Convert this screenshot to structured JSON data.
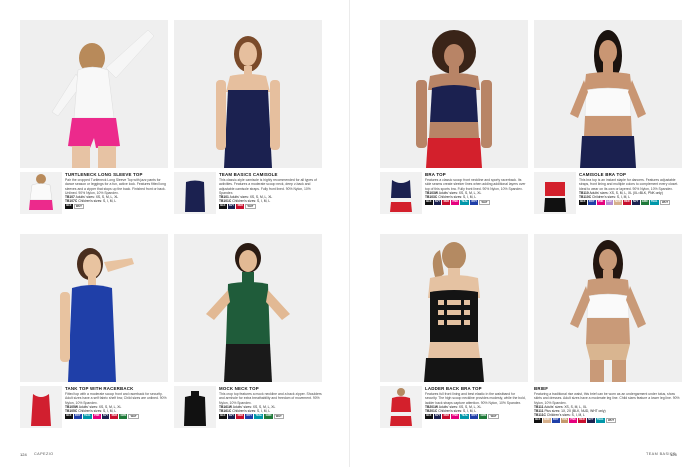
{
  "products": [
    {
      "title": "TURTLENECK LONG SLEEVE TOP",
      "desc": "Pair the cropped Turtleneck Long Sleeve Top with jazz pants for dance season or leggings for a fun, active look. Features fitted long sleeves and a zipper that stops up the back. Finished front or back. Unlined. 90% Nylon, 10% Spandex.",
      "sizes": [
        {
          "code": "TB107",
          "text": "Adults' sizes: XS, S, M, L, XL"
        },
        {
          "code": "TB107C",
          "text": "Children's sizes: S, I, M, L"
        }
      ],
      "swatches": [
        {
          "label": "BLK",
          "color": "#111111",
          "light": false
        },
        {
          "label": "WHT",
          "color": "#ffffff",
          "light": true
        }
      ]
    },
    {
      "title": "TEAM BASICS CAMISOLE",
      "desc": "This classic-style camisole is highly recommended for all types of activities. Features a moderate scoop neck, deep v-back and adjustable camisole straps. Fully front lined. 90% Nylon, 10% Spandex.",
      "sizes": [
        {
          "code": "TB101",
          "text": "Adults' sizes: XS, S, M, L, XL"
        },
        {
          "code": "TB101C",
          "text": "Children's sizes: S, I, M, L"
        }
      ],
      "swatches": [
        {
          "label": "BLK",
          "color": "#111111",
          "light": false
        },
        {
          "label": "NVY",
          "color": "#1c2250",
          "light": false
        },
        {
          "label": "RED",
          "color": "#c8102e",
          "light": false
        },
        {
          "label": "WHT",
          "color": "#ffffff",
          "light": true
        }
      ]
    },
    {
      "title": "BRA TOP",
      "desc": "Features a classic scoop front neckline and sporty racerback. Its side seams create sleeker lines when adding additional layers over top of this sports bra. Fully front lined. 90% Nylon, 10% Spandex.",
      "sizes": [
        {
          "code": "TB103W",
          "text": "Adults' sizes: XS, S, M, L, XL"
        },
        {
          "code": "TB103C",
          "text": "Children's sizes: S, I, M, L"
        }
      ],
      "swatches": [
        {
          "label": "BLK",
          "color": "#111111",
          "light": false
        },
        {
          "label": "NVY",
          "color": "#1c2250",
          "light": false
        },
        {
          "label": "RED",
          "color": "#c8102e",
          "light": false
        },
        {
          "label": "PNK",
          "color": "#e6007e",
          "light": false
        },
        {
          "label": "TEAL",
          "color": "#0097a9",
          "light": false
        },
        {
          "label": "ROY",
          "color": "#1f3fa8",
          "light": false
        },
        {
          "label": "WHT",
          "color": "#ffffff",
          "light": true
        }
      ]
    },
    {
      "title": "CAMISOLE BRA TOP",
      "desc": "This bra top is an instant staple for dancers. Features adjustable straps, front lining and multiple colors to complement every closet. Ideal to wear on its own or layered. 90% Nylon, 10% Spandex.",
      "sizes": [
        {
          "code": "TB110",
          "text": "Adults' sizes: XS, S, M, L, XL (XL=BLK, PNK only)"
        },
        {
          "code": "TB110C",
          "text": "Children's sizes: S, I, M, L"
        }
      ],
      "swatches": [
        {
          "label": "BLK",
          "color": "#111111",
          "light": false
        },
        {
          "label": "ROY",
          "color": "#1f3fa8",
          "light": false
        },
        {
          "label": "PNK",
          "color": "#e6007e",
          "light": false
        },
        {
          "label": "LAV",
          "color": "#b58bd0",
          "light": false
        },
        {
          "label": "NUD",
          "color": "#d6b08c",
          "light": false
        },
        {
          "label": "RED",
          "color": "#c8102e",
          "light": false
        },
        {
          "label": "NVY",
          "color": "#1c2250",
          "light": false
        },
        {
          "label": "GRN",
          "color": "#1f7a3a",
          "light": false
        },
        {
          "label": "TEAL",
          "color": "#0097a9",
          "light": false
        },
        {
          "label": "WHT",
          "color": "#ffffff",
          "light": true
        }
      ]
    },
    {
      "title": "TANK TOP WITH RACERBACK",
      "desc": "Fitted top with a moderate scoop front and racerback for security. Adult sizes have a self fabric shelf bra; Child sizes are unlined. 90% Nylon, 10% Spandex.",
      "sizes": [
        {
          "code": "TB105W",
          "text": "Adults' sizes: XS, S, M, L, XL"
        },
        {
          "code": "TB105C",
          "text": "Children's sizes: S, I, M, L"
        }
      ],
      "swatches": [
        {
          "label": "BLK",
          "color": "#111111",
          "light": false
        },
        {
          "label": "ROY",
          "color": "#1f3fa8",
          "light": false
        },
        {
          "label": "TEAL",
          "color": "#0097a9",
          "light": false
        },
        {
          "label": "PNK",
          "color": "#e6007e",
          "light": false
        },
        {
          "label": "NVY",
          "color": "#1c2250",
          "light": false
        },
        {
          "label": "RED",
          "color": "#c8102e",
          "light": false
        },
        {
          "label": "GRN",
          "color": "#1f7a3a",
          "light": false
        },
        {
          "label": "WHT",
          "color": "#ffffff",
          "light": true
        }
      ]
    },
    {
      "title": "MOCK NECK TOP",
      "desc": "This crop top features a mock neckline and a back zipper. Shoulders and armhole for extra breathability and freedom of movement. 90% Nylon, 10% Spandex.",
      "sizes": [
        {
          "code": "TB161W",
          "text": "Adults' sizes: XS, S, M, L, XL"
        },
        {
          "code": "TB161C",
          "text": "Children's sizes: S, I, M, L"
        }
      ],
      "swatches": [
        {
          "label": "BLK",
          "color": "#111111",
          "light": false
        },
        {
          "label": "NVY",
          "color": "#1c2250",
          "light": false
        },
        {
          "label": "RED",
          "color": "#c8102e",
          "light": false
        },
        {
          "label": "ROY",
          "color": "#1f3fa8",
          "light": false
        },
        {
          "label": "TEAL",
          "color": "#0097a9",
          "light": false
        },
        {
          "label": "GRN",
          "color": "#1f7a3a",
          "light": false
        },
        {
          "label": "WHT",
          "color": "#ffffff",
          "light": true
        }
      ]
    },
    {
      "title": "LADDER BACK BRA TOP",
      "desc": "Features full front lining and best elastic in the waistband for security. The high scoop neckline provides modesty, while the bold, ladder back straps capture attention. 90% Nylon, 10% Spandex.",
      "sizes": [
        {
          "code": "TB201W",
          "text": "Adults' sizes: XS, S, M, L, XL"
        },
        {
          "code": "TB201C",
          "text": "Children's sizes: S, I, M, L"
        }
      ],
      "swatches": [
        {
          "label": "BLK",
          "color": "#111111",
          "light": false
        },
        {
          "label": "NVY",
          "color": "#1c2250",
          "light": false
        },
        {
          "label": "RED",
          "color": "#c8102e",
          "light": false
        },
        {
          "label": "PNK",
          "color": "#e6007e",
          "light": false
        },
        {
          "label": "TEAL",
          "color": "#0097a9",
          "light": false
        },
        {
          "label": "ROY",
          "color": "#1f3fa8",
          "light": false
        },
        {
          "label": "GRN",
          "color": "#1f7a3a",
          "light": false
        },
        {
          "label": "WHT",
          "color": "#ffffff",
          "light": true
        }
      ]
    },
    {
      "title": "BRIEF",
      "desc": "Featuring a traditional rise waist, this brief can be worn as an undergarment under tutus, show skirts and dresses. Adult sizes have a moderate leg line. Child sizes feature a lower leg line. 90% Nylon, 10% Spandex.",
      "sizes": [
        {
          "code": "TB111",
          "text": "Adults' sizes: XS, S, M, L, XL"
        },
        {
          "code": "TB111",
          "text": "Plus sizes: 1X, 2X (BLK, NUD, WHT only)"
        },
        {
          "code": "TB111C",
          "text": "Children's sizes: S, I, M, L"
        }
      ],
      "swatches": [
        {
          "label": "BLK",
          "color": "#111111",
          "light": false
        },
        {
          "label": "NUD",
          "color": "#d6b08c",
          "light": false
        },
        {
          "label": "ROY",
          "color": "#1f3fa8",
          "light": false
        },
        {
          "label": "TAN",
          "color": "#c59a6d",
          "light": false
        },
        {
          "label": "PNK",
          "color": "#e6007e",
          "light": false
        },
        {
          "label": "RED",
          "color": "#c8102e",
          "light": false
        },
        {
          "label": "NVY",
          "color": "#1c2250",
          "light": false
        },
        {
          "label": "TEAL",
          "color": "#0097a9",
          "light": false
        },
        {
          "label": "WHT",
          "color": "#ffffff",
          "light": true
        }
      ]
    }
  ],
  "footer": {
    "left_page_number": "124",
    "left_label": "CAPEZIO",
    "right_label": "TEAM BASICS",
    "right_page_number": "125"
  }
}
